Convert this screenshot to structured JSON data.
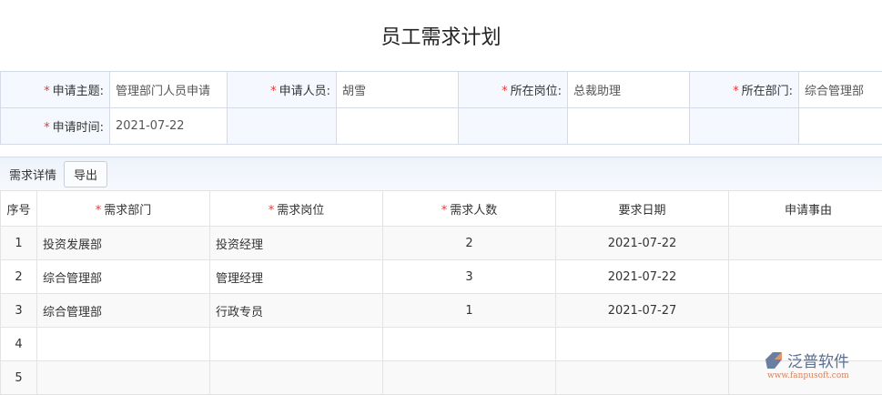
{
  "title": "员工需求计划",
  "form": {
    "subject_label": "申请主题:",
    "subject": "管理部门人员申请",
    "applicant_label": "申请人员:",
    "applicant": "胡雪",
    "position_label": "所在岗位:",
    "position": "总裁助理",
    "dept_label": "所在部门:",
    "dept": "综合管理部",
    "time_label": "申请时间:",
    "time": "2021-07-22"
  },
  "section": {
    "label": "需求详情",
    "export": "导出"
  },
  "table": {
    "headers": [
      "序号",
      "需求部门",
      "需求岗位",
      "需求人数",
      "要求日期",
      "申请事由"
    ],
    "rows": [
      [
        "1",
        "投资发展部",
        "投资经理",
        "2",
        "2021-07-22",
        ""
      ],
      [
        "2",
        "综合管理部",
        "管理经理",
        "3",
        "2021-07-22",
        ""
      ],
      [
        "3",
        "综合管理部",
        "行政专员",
        "1",
        "2021-07-27",
        ""
      ],
      [
        "4",
        "",
        "",
        "",
        "",
        ""
      ],
      [
        "5",
        "",
        "",
        "",
        "",
        ""
      ]
    ]
  },
  "watermark": {
    "name": "泛普软件",
    "url": "www.fanpusoft.com"
  }
}
